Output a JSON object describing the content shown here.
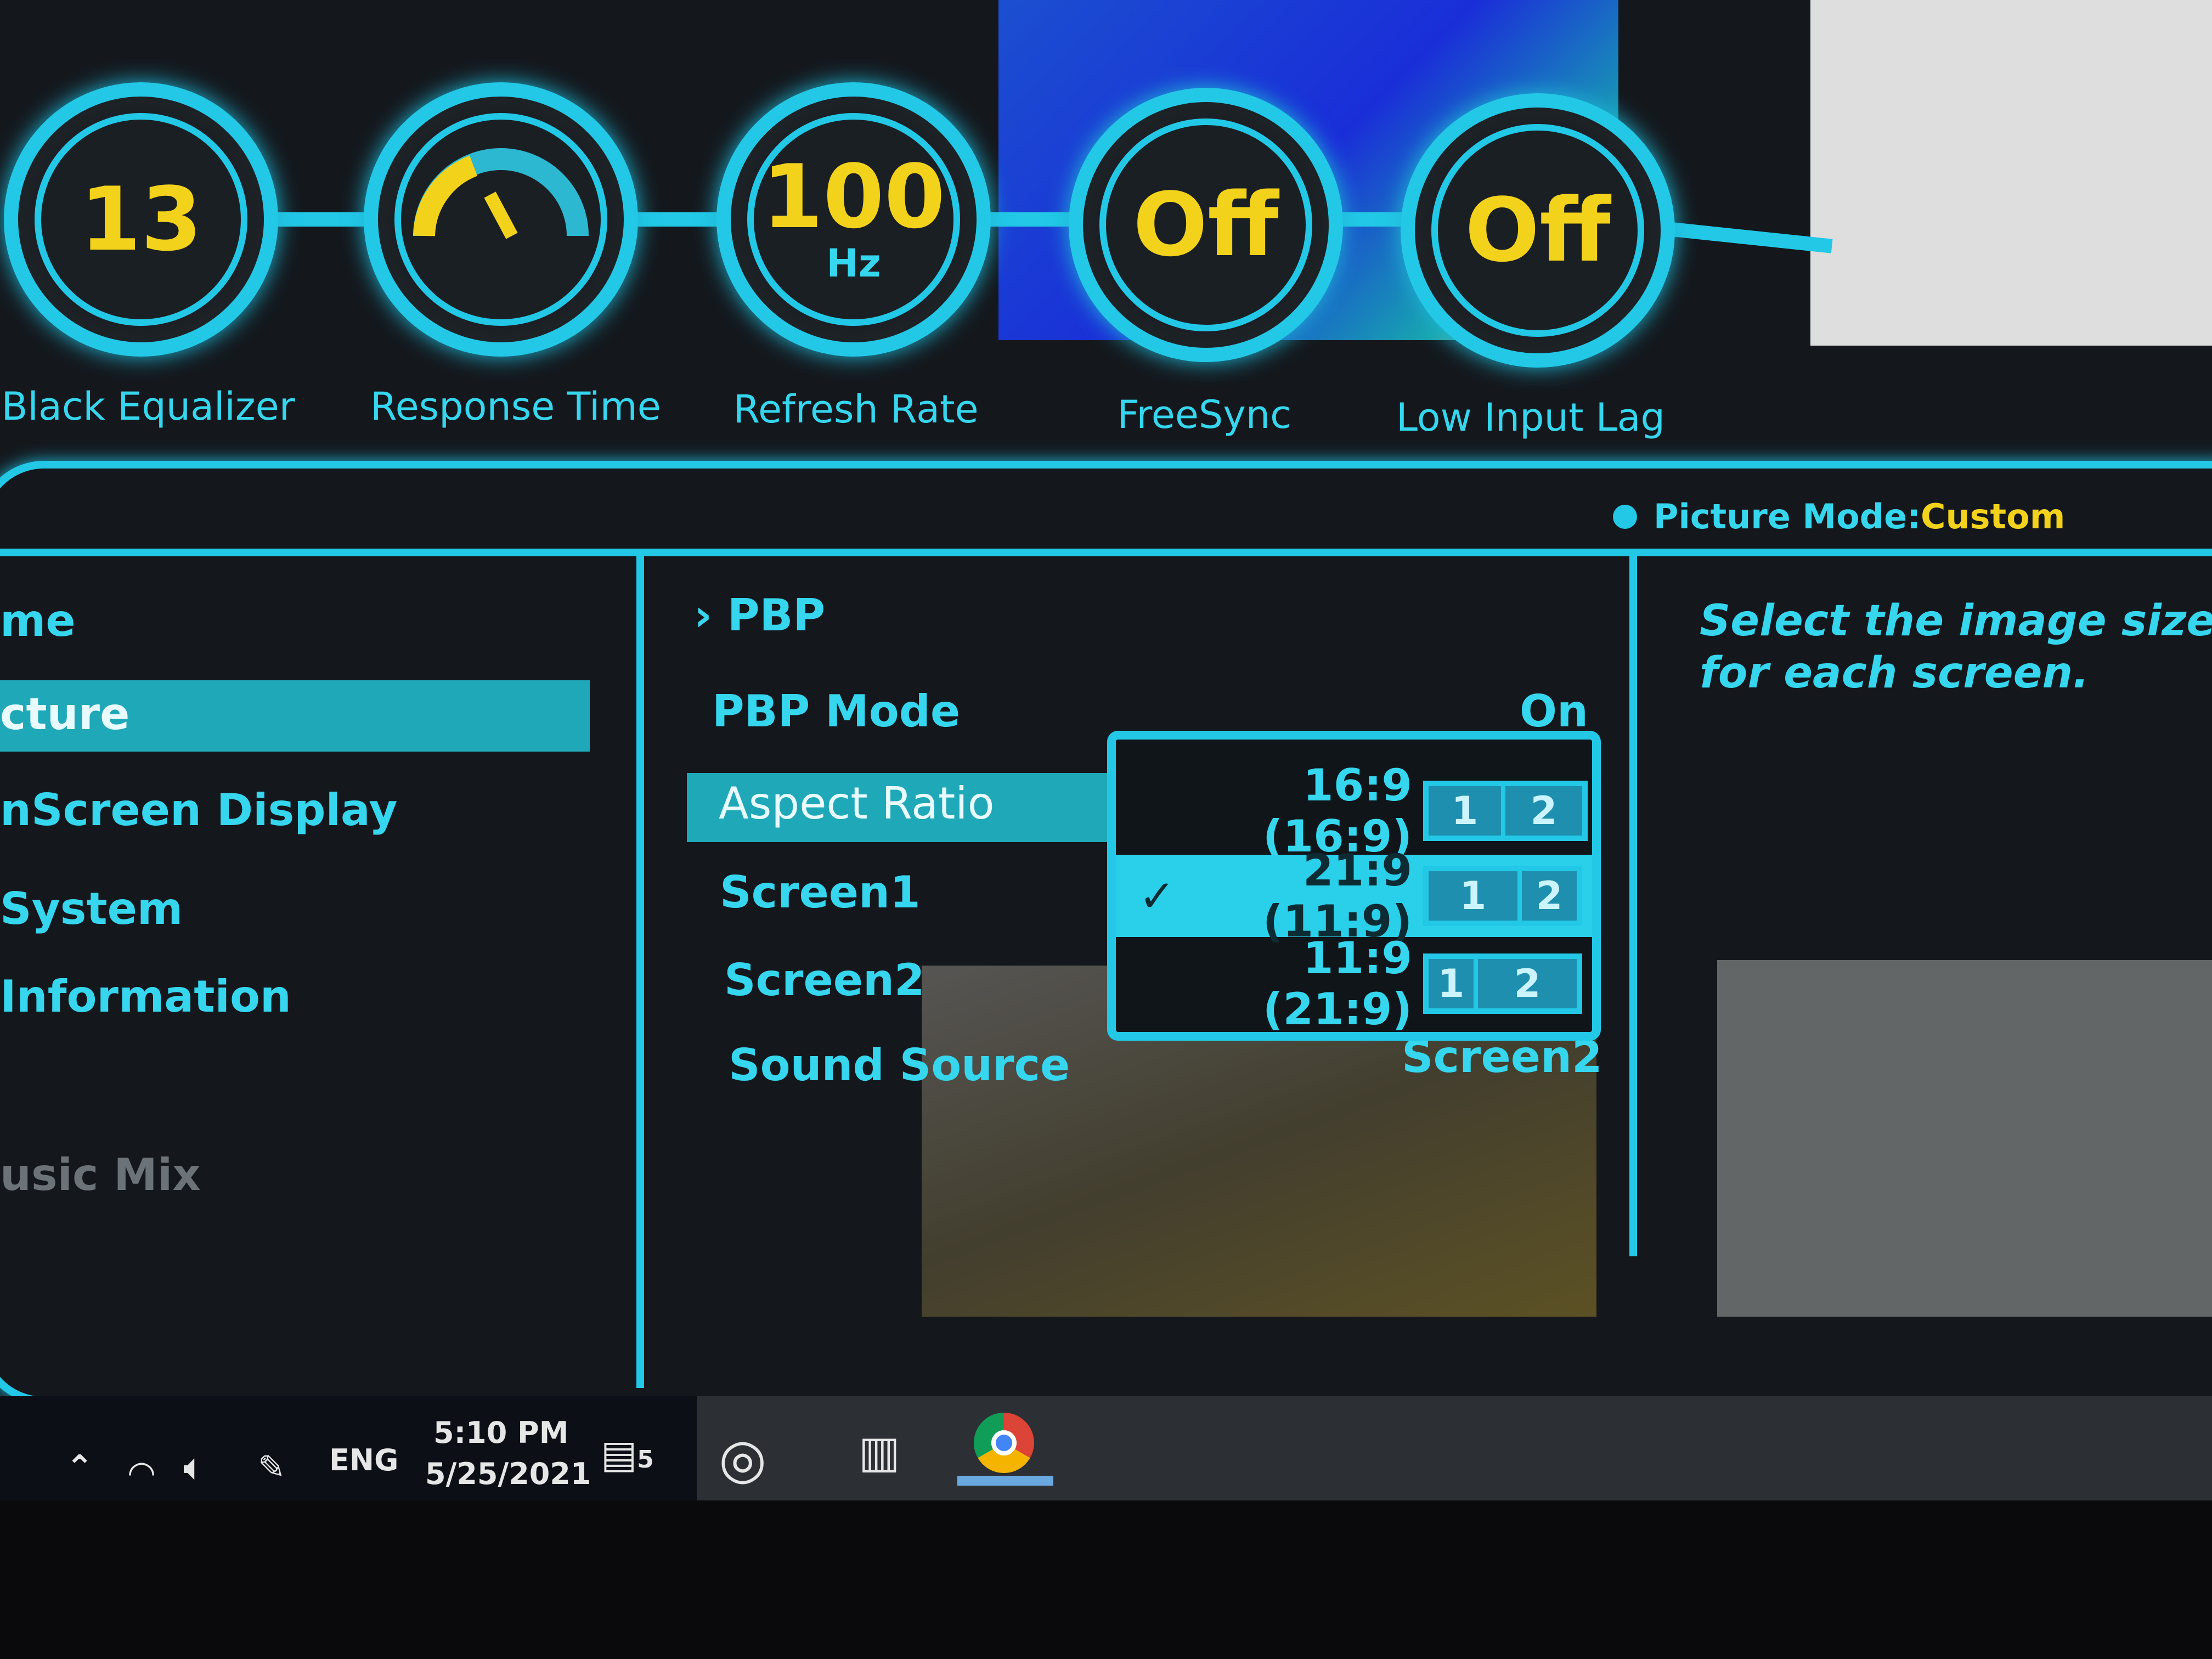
{
  "gauges": [
    {
      "value": "13",
      "unit": "",
      "label": "Black Equalizer"
    },
    {
      "value": "",
      "unit": "",
      "label": "Response Time",
      "icon": "speedometer-icon"
    },
    {
      "value": "100",
      "unit": "Hz",
      "label": "Refresh Rate"
    },
    {
      "value": "Off",
      "unit": "",
      "label": "FreeSync"
    },
    {
      "value": "Off",
      "unit": "",
      "label": "Low Input Lag"
    }
  ],
  "status": {
    "picture_mode_label": "Picture Mode:",
    "picture_mode_value": "Custom"
  },
  "left_menu": {
    "items": [
      "me",
      "cture",
      "nScreen Display",
      "System",
      "Information",
      "usic Mix"
    ],
    "selected": 1
  },
  "middle": {
    "header": "PBP",
    "items": [
      {
        "label": "PBP Mode",
        "value": "On"
      },
      {
        "label": "Aspect Ratio",
        "value": ""
      },
      {
        "label": "Screen1",
        "value": ""
      },
      {
        "label": "Screen2",
        "value": ""
      },
      {
        "label": "Sound Source",
        "value": "Screen2"
      }
    ]
  },
  "dropdown": {
    "options": [
      {
        "label": "16:9 (16:9)",
        "checked": false,
        "screens": [
          "1",
          "2"
        ]
      },
      {
        "label": "21:9 (11:9)",
        "checked": true,
        "screens": [
          "1",
          "2"
        ]
      },
      {
        "label": "11:9 (21:9)",
        "checked": false,
        "screens": [
          "1",
          "2"
        ]
      }
    ]
  },
  "help": {
    "text": "Select the image size for each screen."
  },
  "taskbar": {
    "lang": "ENG",
    "time": "5:10 PM",
    "date": "5/25/2021",
    "notifications": "5"
  },
  "colors": {
    "accent": "#22c8e6",
    "value": "#f2d21a",
    "background": "#14181d"
  }
}
